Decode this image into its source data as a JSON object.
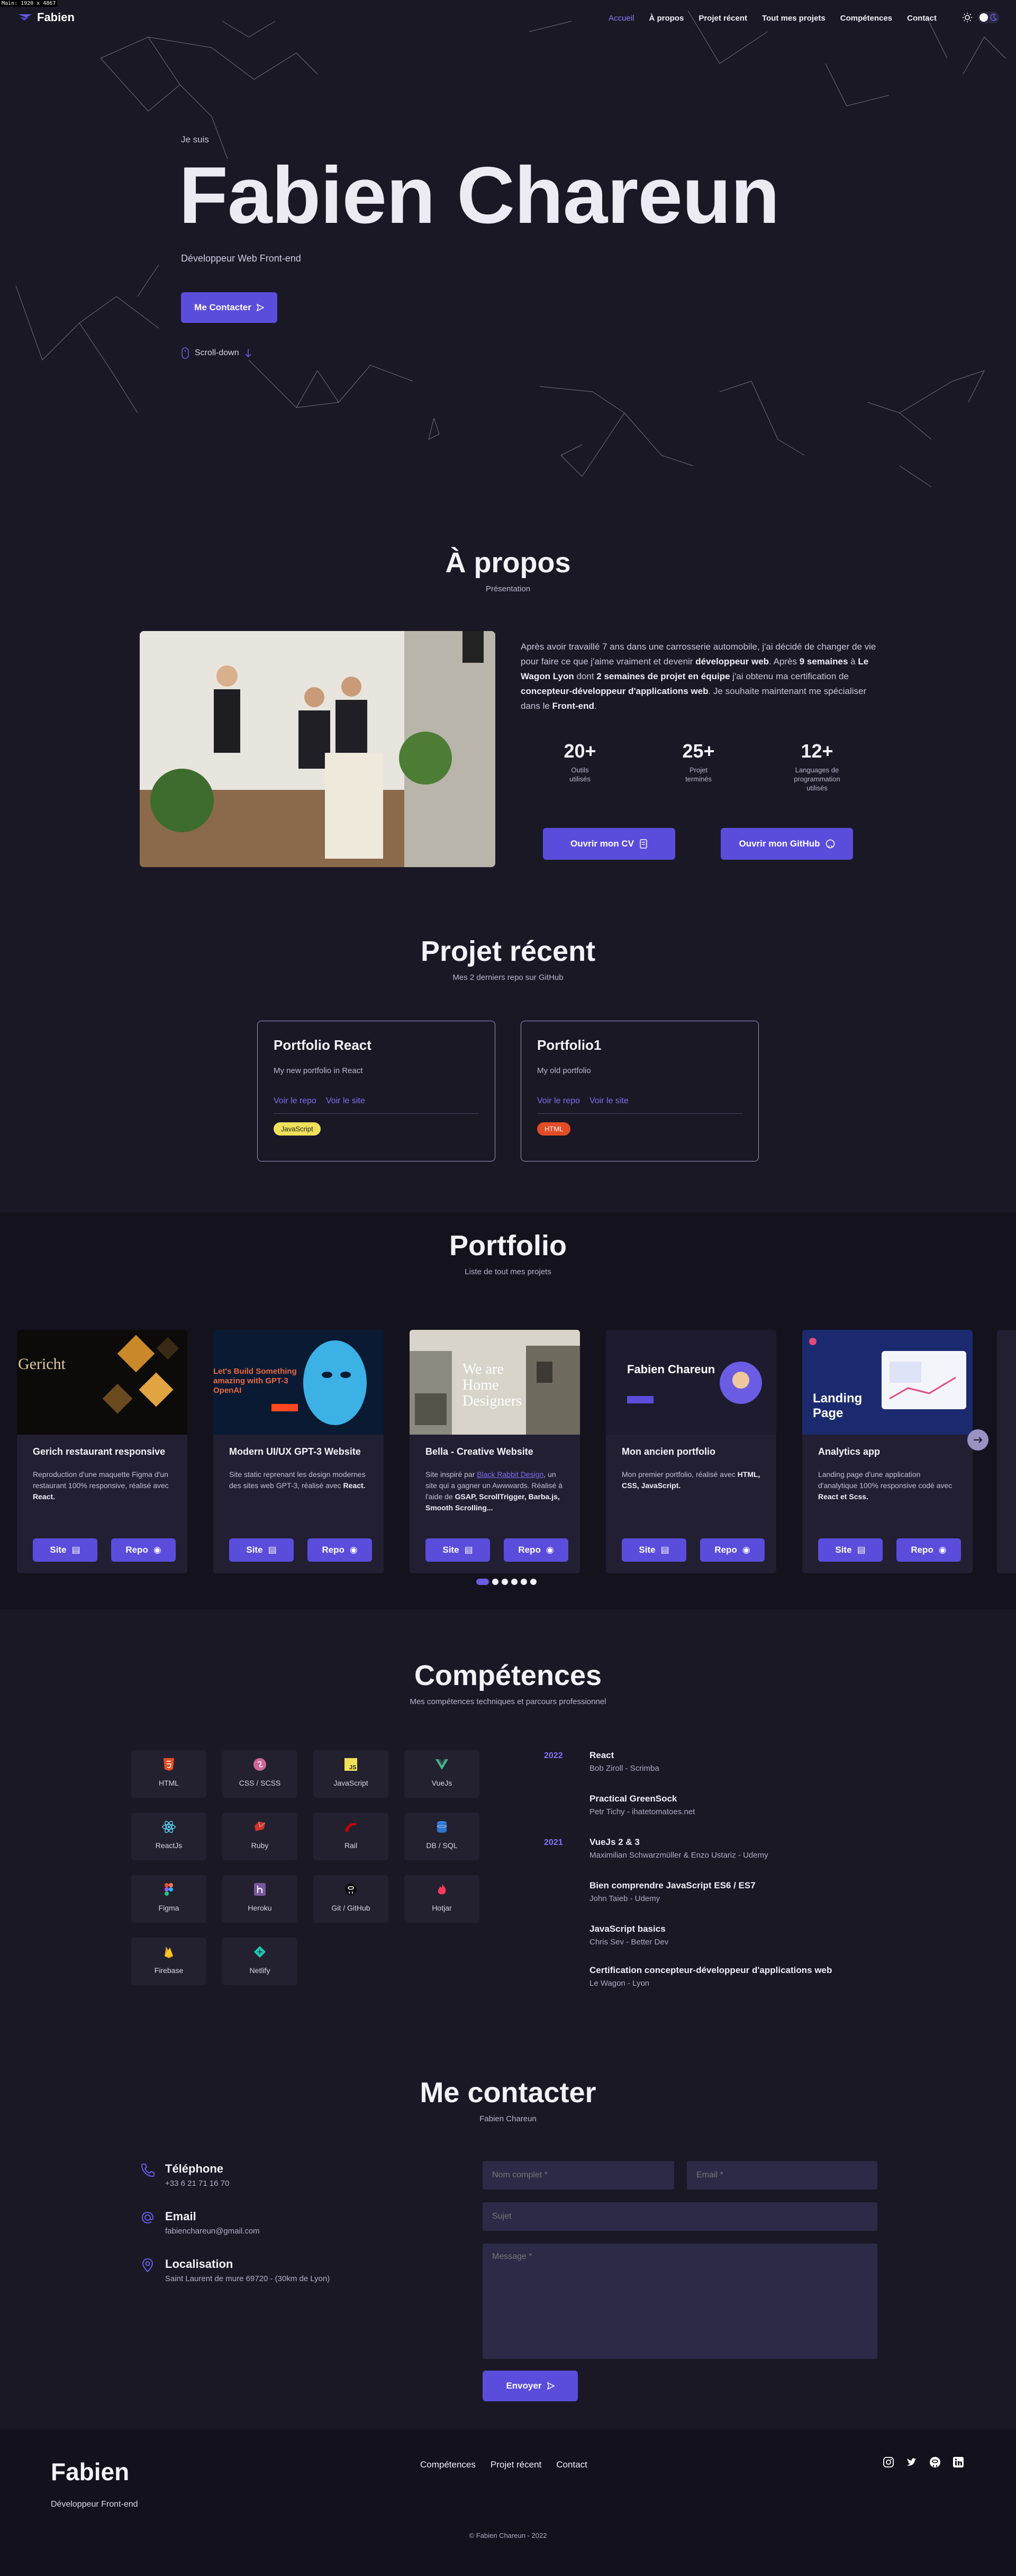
{
  "debug": "Main: 1920 x 4867",
  "nav": {
    "logo": "Fabien",
    "links": [
      "Accueil",
      "À propos",
      "Projet récent",
      "Tout mes projets",
      "Compétences",
      "Contact"
    ]
  },
  "hero": {
    "intro": "Je suis",
    "name": "Fabien Chareun",
    "role": "Développeur Web Front-end",
    "cta": "Me Contacter",
    "scroll": "Scroll-down"
  },
  "about": {
    "title": "À propos",
    "subtitle": "Présentation",
    "paragraph_parts": [
      "Après avoir travaillé 7 ans dans une carrosserie automobile, j'ai décidé de changer de vie pour faire ce que j'aime vraiment et devenir ",
      "développeur web",
      ". Après ",
      "9 semaines",
      " à ",
      "Le Wagon Lyon",
      " dont ",
      "2 semaines de projet en équipe",
      " j'ai obtenu ma certification de ",
      "concepteur-développeur d'applications web",
      ". Je souhaite maintenant me spécialiser dans le ",
      "Front-end",
      "."
    ],
    "stats": [
      {
        "num": "20+",
        "label": "Outils utilisés"
      },
      {
        "num": "25+",
        "label": "Projet terminés"
      },
      {
        "num": "12+",
        "label": "Languages de programmation utilisés"
      }
    ],
    "cv_button": "Ouvrir mon CV",
    "github_button": "Ouvrir mon GitHub"
  },
  "recent": {
    "title": "Projet récent",
    "subtitle": "Mes 2 derniers repo sur GitHub",
    "cards": [
      {
        "title": "Portfolio React",
        "desc": "My new portfolio in React",
        "repo": "Voir le repo",
        "site": "Voir le site",
        "tag": "JavaScript",
        "tag_color": "#f1e05a"
      },
      {
        "title": "Portfolio1",
        "desc": "My old portfolio",
        "repo": "Voir le repo",
        "site": "Voir le site",
        "tag": "HTML",
        "tag_color": "#e34c26"
      }
    ]
  },
  "portfolio": {
    "title": "Portfolio",
    "subtitle": "Liste de tout mes projets",
    "site_label": "Site",
    "repo_label": "Repo",
    "cards": [
      {
        "title": "Gerich restaurant responsive",
        "desc": "Reproduction d'une maquette Figma d'un restaurant 100% responsive, réalisé avec ",
        "tech": "React."
      },
      {
        "title": "Modern UI/UX GPT-3 Website",
        "desc": "Site static reprenant les design modernes des sites web GPT-3, réalisé avec ",
        "tech": "React."
      },
      {
        "title": "Bella - Creative Website",
        "desc": "Site inspiré par ",
        "link": "Black Rabbit Design",
        "desc2": ", un site qui a gagner un Awwwards. Réalisé à l'aide de ",
        "tech": "GSAP, ScrollTrigger, Barba.js, Smooth Scrolling..."
      },
      {
        "title": "Mon ancien portfolio",
        "desc": "Mon premier portfolio, réalisé avec ",
        "tech": "HTML, CSS, JavaScript."
      },
      {
        "title": "Analytics app",
        "desc": "Landing page d'une application d'analytique 100% responsive codé avec ",
        "tech": "React et Scss."
      }
    ],
    "thumb_texts": {
      "gericht": "Gericht",
      "gpt": "Let's Build Something amazing with GPT-3 OpenAI",
      "bella": "We are Home Designers",
      "old": "Fabien Chareun",
      "analytics": "Landing Page"
    }
  },
  "skills": {
    "title": "Compétences",
    "subtitle": "Mes compétences techniques et parcours professionnel",
    "items": [
      "HTML",
      "CSS / SCSS",
      "JavaScript",
      "VueJs",
      "ReactJs",
      "Ruby",
      "Rail",
      "DB / SQL",
      "Figma",
      "Heroku",
      "Git / GitHub",
      "Hotjar",
      "Firebase",
      "Netlify"
    ],
    "years": [
      "2022",
      "2021"
    ],
    "courses": [
      {
        "title": "React",
        "source": "Bob Ziroll - Scrimba"
      },
      {
        "title": "Practical GreenSock",
        "source": "Petr Tichy - ihatetomatoes.net"
      },
      {
        "title": "VueJs 2 & 3",
        "source": "Maximilian Schwarzmüller & Enzo Ustariz - Udemy"
      },
      {
        "title": "Bien comprendre JavaScript ES6 / ES7",
        "source": "John Taieb - Udemy"
      },
      {
        "title": "JavaScript basics",
        "source": "Chris Sev - Better Dev"
      },
      {
        "title": "Certification concepteur-développeur d'applications web",
        "source": "Le Wagon - Lyon"
      }
    ]
  },
  "contact": {
    "title": "Me contacter",
    "subtitle": "Fabien Chareun",
    "phone_title": "Téléphone",
    "phone": "+33 6 21 71 16 70",
    "email_title": "Email",
    "email": "fabienchareun@gmail.com",
    "loc_title": "Localisation",
    "loc": "Saint Laurent de mure 69720 - (30km de Lyon)",
    "placeholder_name": "Nom complet *",
    "placeholder_email": "Email *",
    "placeholder_subject": "Sujet",
    "placeholder_message": "Message *",
    "send": "Envoyer"
  },
  "footer": {
    "title": "Fabien",
    "subtitle": "Développeur Front-end",
    "links": [
      "Compétences",
      "Projet récent",
      "Contact"
    ],
    "copyright": "© Fabien Chareun - 2022"
  },
  "colors": {
    "accent": "#5b4ddb",
    "background": "#1a1825",
    "link": "#7e6ff0"
  }
}
